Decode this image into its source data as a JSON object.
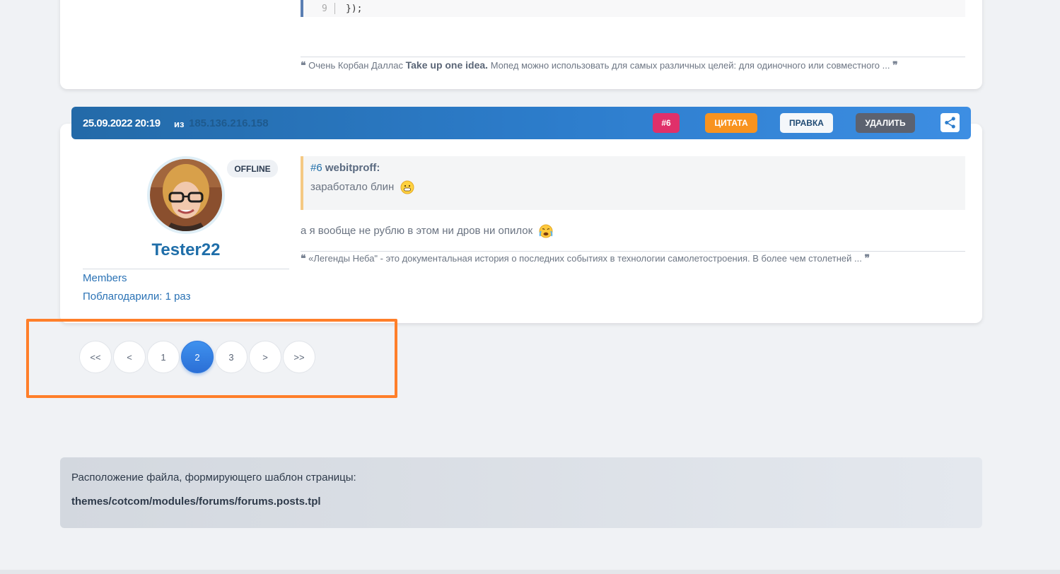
{
  "prev_post": {
    "code_line_number": "9",
    "code_text": "});",
    "signature_prefix": "Очень Корбан Даллас",
    "signature_bold": "Take up one idea.",
    "signature_rest": "Мопед можно использовать для самых различных целей: для одиночного или совместного ..."
  },
  "post": {
    "date": "25.09.2022 20:19",
    "from_label": "из",
    "ip": "185.136.216.158",
    "buttons": {
      "number": "#6",
      "quote": "ЦИТАТА",
      "edit": "ПРАВКА",
      "delete": "УДАЛИТЬ"
    },
    "share_icon": "share-icon",
    "author": {
      "status": "OFFLINE",
      "username": "Tester22",
      "group": "Members",
      "thanks": "Поблагодарили: 1 раз"
    },
    "quote": {
      "number": "#6",
      "author": "webitproff:",
      "text": "заработало блин"
    },
    "text": "а я вообще не рублю в этом ни дров ни опилок",
    "signature": "«Легенды Неба\" - это документальная история о последних событиях в технологии самолетостроения. В более чем столетней ..."
  },
  "pagination": {
    "first": "<<",
    "prev": "<",
    "pages": [
      "1",
      "2",
      "3"
    ],
    "active_page": "2",
    "next": ">",
    "last": ">>"
  },
  "template_info": {
    "label": "Расположение файла, формирующего шаблон страницы:",
    "path": "themes/cotcom/modules/forums/forums.posts.tpl"
  },
  "colors": {
    "accent": "#2d7dcc",
    "highlight": "#ff7f2a",
    "quote_button": "#f8931f",
    "number_button": "#e0306a"
  }
}
